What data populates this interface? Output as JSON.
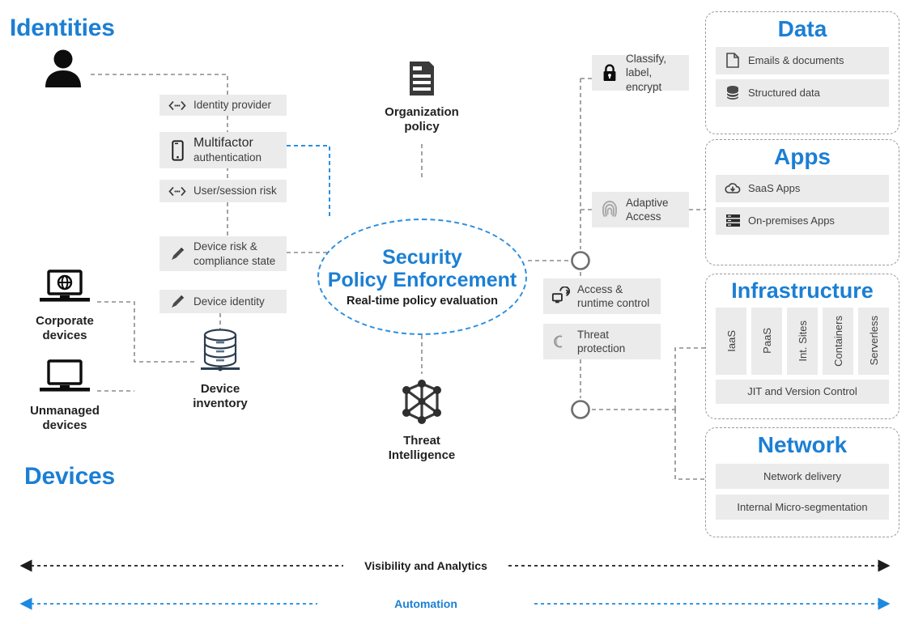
{
  "pillars": {
    "identities": "Identities",
    "devices": "Devices"
  },
  "left_nodes": [
    {
      "name": "person-icon",
      "caption": ""
    },
    {
      "name": "corporate-devices",
      "caption_line1": "Corporate",
      "caption_line2": "devices"
    },
    {
      "name": "unmanaged-devices",
      "caption_line1": "Unmanaged",
      "caption_line2": "devices"
    },
    {
      "name": "device-inventory",
      "caption_line1": "Device",
      "caption_line2": "inventory"
    }
  ],
  "identity_chips": [
    {
      "icon": "signal-exchange-icon",
      "label": "Identity  provider"
    },
    {
      "icon": "mobile-phone-icon",
      "label_big": "Multifactor",
      "label_small": "authentication"
    },
    {
      "icon": "signal-exchange-icon",
      "label": "User/session risk"
    }
  ],
  "device_chips": [
    {
      "icon": "pencil-icon",
      "line1": "Device  risk &",
      "line2": "compliance  state"
    },
    {
      "icon": "pencil-icon",
      "line1": "Device  identity",
      "line2": ""
    }
  ],
  "center": {
    "org_policy": {
      "icon": "document-policy-icon",
      "line1": "Organization",
      "line2": "policy"
    },
    "threat_intel": {
      "icon": "network-graph-icon",
      "line1": "Threat",
      "line2": "Intelligence"
    },
    "ellipse": {
      "line1": "Security",
      "line2": "Policy  Enforcement",
      "line3": "Real-time policy evaluation"
    }
  },
  "enforcement_chips": [
    {
      "icon": "lock-icon",
      "line1": "Classify,",
      "line2": "label, encrypt"
    },
    {
      "icon": "fingerprint-icon",
      "line1": "Adaptive",
      "line2": "Access"
    },
    {
      "icon": "access-control-icon",
      "line1": "Access &",
      "line2": "runtime  control"
    },
    {
      "icon": "threat-shield-icon",
      "line1": "Threat",
      "line2": "protection"
    }
  ],
  "panels": [
    {
      "key": "data",
      "title": "Data",
      "rows": [
        {
          "icon": "document-icon",
          "label": "Emails & documents"
        },
        {
          "icon": "database-icon",
          "label": "Structured data"
        }
      ]
    },
    {
      "key": "apps",
      "title": "Apps",
      "rows": [
        {
          "icon": "cloud-download-icon",
          "label": "SaaS Apps"
        },
        {
          "icon": "server-rack-icon",
          "label": "On-premises Apps"
        }
      ]
    },
    {
      "key": "infrastructure",
      "title": "Infrastructure",
      "columns": [
        "IaaS",
        "PaaS",
        "Int. Sites",
        "Containers",
        "Serverless"
      ],
      "footer": "JIT and Version  Control"
    },
    {
      "key": "network",
      "title": "Network",
      "rows": [
        {
          "label": "Network delivery"
        },
        {
          "label": "Internal Micro-segmentation"
        }
      ]
    }
  ],
  "bottom_axes": [
    {
      "label": "Visibility and Analytics",
      "color": "#1c1c1c"
    },
    {
      "label": "Automation",
      "color": "#1b7fd4"
    }
  ],
  "colors": {
    "accent_blue": "#1b7fd4",
    "line_blue": "#2b8fe0",
    "chip_bg": "#ebebeb",
    "wire_gray": "#8c8c8c",
    "text_dark": "#3f3f3f"
  }
}
